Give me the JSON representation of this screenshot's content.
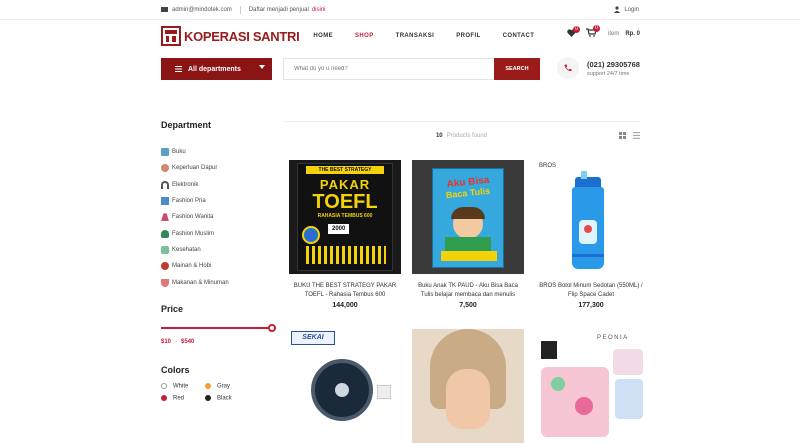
{
  "topbar": {
    "email": "admin@mindotek.com",
    "seller_text": "Daftar menjadi penjual",
    "seller_link": "disini",
    "login": "Login"
  },
  "header": {
    "logo_text": "KOPERASI SANTRI",
    "nav": [
      "HOME",
      "SHOP",
      "TRANSAKSI",
      "PROFIL",
      "CONTACT"
    ],
    "active_nav": "SHOP",
    "wishlist_count": "0",
    "cart_count": "0",
    "cart_label": "item",
    "cart_total": "Rp. 0"
  },
  "search": {
    "departments_label": "All departments",
    "placeholder": "What do yo u need?",
    "button": "SEARCH",
    "phone": "(021) 29305768",
    "support": "support 24/7 time"
  },
  "sidebar": {
    "department_title": "Department",
    "categories": [
      {
        "label": "Buku",
        "icon": "book-icon"
      },
      {
        "label": "Keperluan Dapur",
        "icon": "kitchen-icon"
      },
      {
        "label": "Elektronik",
        "icon": "headphones-icon"
      },
      {
        "label": "Fashion Pria",
        "icon": "shirt-icon"
      },
      {
        "label": "Fashion Wanita",
        "icon": "dress-icon"
      },
      {
        "label": "Fashion Muslim",
        "icon": "hijab-icon"
      },
      {
        "label": "Kesehatan",
        "icon": "health-icon"
      },
      {
        "label": "Mainan & Hobi",
        "icon": "toy-icon"
      },
      {
        "label": "Makanan & Minuman",
        "icon": "food-icon"
      }
    ],
    "price_title": "Price",
    "price_min": "$10",
    "price_sep": "-",
    "price_max": "$540",
    "colors_title": "Colors",
    "colors": [
      {
        "label": "White",
        "color": "#ffffff"
      },
      {
        "label": "Gray",
        "color": "#f0a030"
      },
      {
        "label": "Red",
        "color": "#c41e3a"
      },
      {
        "label": "Black",
        "color": "#222222"
      }
    ]
  },
  "main": {
    "count": "10",
    "count_label": "Products found",
    "products": [
      {
        "name": "BUKU THE BEST STRATEGY PAKAR TOEFL - Rahasia Tembus 600",
        "price": "144,000"
      },
      {
        "name": "Buku Anak TK PAUD - Aku Bisa Baca Tulis belajar membaca dan menulis",
        "price": "7,500"
      },
      {
        "name": "BROS Botol Minum Sedotan (550ML) / Flip Space Cadet",
        "price": "177,300",
        "brand": "BROS"
      },
      {
        "name": "",
        "price": "",
        "brand": "SEKAI"
      },
      {
        "name": "",
        "price": ""
      },
      {
        "name": "",
        "price": "",
        "brand": "PEONIA"
      }
    ],
    "book1": {
      "top": "THE BEST STRATEGY",
      "line1": "PAKAR",
      "line2": "TOEFL",
      "line3": "RAHASIA TEMBUS 600",
      "badge": "2000"
    },
    "book2": {
      "line1": "Aku Bisa",
      "line2": "Baca Tulis"
    }
  },
  "colors": {
    "brand": "#9b1b1b",
    "accent": "#c41e3a"
  }
}
